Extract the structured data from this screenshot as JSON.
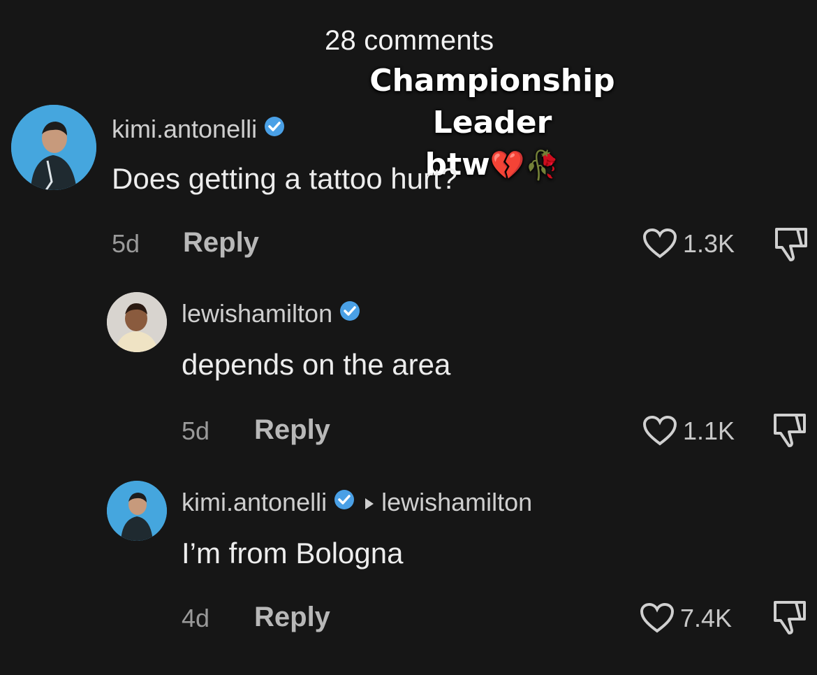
{
  "header": {
    "comment_count": "28 comments"
  },
  "overlay": {
    "line1": "Championship Leader",
    "line2": "btw",
    "emoji": "💔🥀"
  },
  "comments": [
    {
      "username": "kimi.antonelli",
      "verified": true,
      "text": "Does getting a tattoo hurt?",
      "time": "5d",
      "reply_label": "Reply",
      "likes": "1.3K"
    },
    {
      "username": "lewishamilton",
      "verified": true,
      "text": "depends on the area",
      "time": "5d",
      "reply_label": "Reply",
      "likes": "1.1K"
    },
    {
      "username": "kimi.antonelli",
      "verified": true,
      "reply_to": "lewishamilton",
      "text": "I’m from Bologna",
      "time": "4d",
      "reply_label": "Reply",
      "likes": "7.4K"
    }
  ],
  "colors": {
    "background": "#161616",
    "verified": "#4aa0e6",
    "text": "#ededed",
    "muted": "#9a9a9a"
  },
  "icons": [
    "verified-badge-icon",
    "heart-icon",
    "dislike-icon",
    "reply-to-arrow-icon"
  ]
}
